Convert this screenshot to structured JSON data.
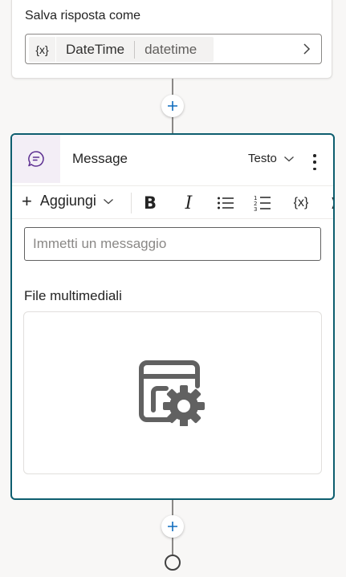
{
  "save_node": {
    "label": "Salva risposta come",
    "variable_icon": "{x}",
    "variable_name": "DateTime",
    "variable_type": "datetime",
    "chevron": "chevron-right-icon"
  },
  "message_node": {
    "icon": "chat-bubble-icon",
    "title": "Message",
    "type_label": "Testo",
    "toolbar": {
      "add_label": "Aggiungi",
      "bold": "B",
      "italic": "I",
      "variable": "{x}"
    },
    "input_placeholder": "Immetti un messaggio",
    "media_label": "File multimediali",
    "media_icon": "media-settings-icon"
  },
  "colors": {
    "accent_border": "#0e5e6f",
    "add_icon": "#0f6cbd",
    "icon_bg": "#f3eef6"
  }
}
